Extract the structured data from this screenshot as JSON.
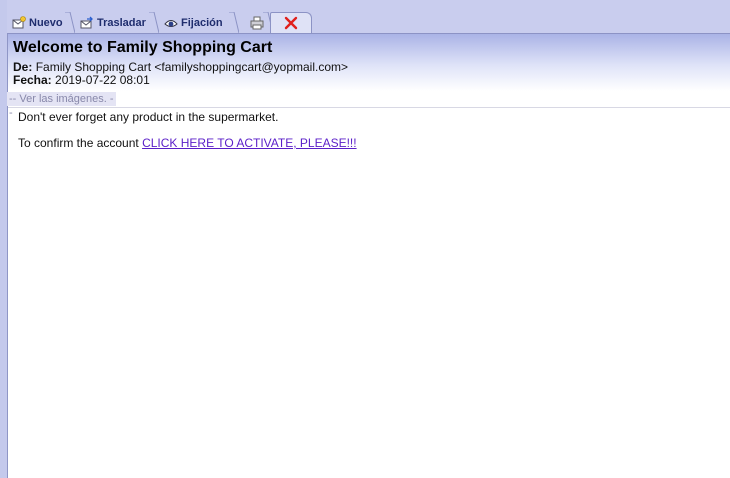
{
  "toolbar": {
    "tabs": [
      {
        "label": "Nuevo",
        "icon": "new-message-icon"
      },
      {
        "label": "Trasladar",
        "icon": "move-icon"
      },
      {
        "label": "Fijación",
        "icon": "eye-icon"
      },
      {
        "label": "",
        "icon": "print-icon"
      },
      {
        "label": "",
        "icon": "delete-icon"
      }
    ]
  },
  "email": {
    "subject": "Welcome to Family Shopping Cart",
    "from_label": "De:",
    "from_value": "Family Shopping Cart <familyshoppingcart@yopmail.com>",
    "date_label": "Fecha:",
    "date_value": "2019-07-22 08:01",
    "images_notice": "-- Ver las imágenes. --",
    "body_line1": "Don't ever forget any product in the supermarket.",
    "body_line2_prefix": "To confirm the account",
    "activate_link": "CLICK HERE TO ACTIVATE, PLEASE!!!"
  },
  "colors": {
    "tabbar_bg": "#c9cdee",
    "header_gradient_top": "#aab3e6",
    "link": "#5a1ec8",
    "delete_icon": "#e0201c"
  }
}
